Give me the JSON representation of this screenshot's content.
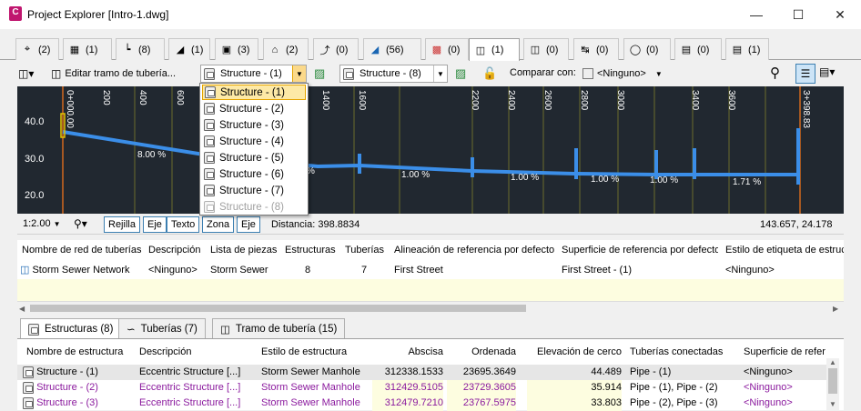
{
  "window": {
    "title": "Project Explorer [Intro-1.dwg]",
    "app_icon": "C"
  },
  "top_tabs": [
    {
      "count": "(2)"
    },
    {
      "count": "(1)"
    },
    {
      "count": "(8)"
    },
    {
      "count": "(1)"
    },
    {
      "count": "(3)"
    },
    {
      "count": "(2)"
    },
    {
      "count": "(0)"
    },
    {
      "count": "(56)"
    },
    {
      "count": "(0)"
    },
    {
      "count": "(1)"
    },
    {
      "count": "(0)"
    },
    {
      "count": "(0)"
    },
    {
      "count": "(0)"
    },
    {
      "count": "(0)"
    },
    {
      "count": "(1)"
    }
  ],
  "toolbar": {
    "edit_label": "Editar tramo de tubería...",
    "start_structure": "Structure - (1)",
    "end_structure": "Structure - (8)",
    "compare_label": "Comparar con:",
    "compare_value": "<Ninguno>"
  },
  "profile": {
    "y_labels": [
      "40.0",
      "30.0",
      "20.0"
    ],
    "x_labels": [
      "0+000.00",
      "200",
      "400",
      "600",
      "1400",
      "1600",
      "2200",
      "2400",
      "2600",
      "2800",
      "3000",
      "3400",
      "3600",
      "3+398.83"
    ],
    "slopes": [
      "8.00 %",
      "%",
      "1.00 %",
      "1.00 %",
      "1.00 %",
      "1.00 %",
      "1.71 %"
    ]
  },
  "status": {
    "scale": "1:2.00",
    "buttons": [
      "Rejilla",
      "Eje",
      "Texto",
      "Zona",
      "Eje"
    ],
    "distance": "Distancia: 398.8834",
    "coords": "143.657, 24.178"
  },
  "network_grid": {
    "headers": [
      "Nombre de red de tuberías",
      "Descripción",
      "Lista de piezas",
      "Estructuras",
      "Tuberías",
      "Alineación de referencia por defecto",
      "Superficie de referencia por defecto",
      "Estilo de etiqueta de estruct"
    ],
    "row": [
      "Storm Sewer Network",
      "<Ninguno>",
      "Storm Sewer",
      "8",
      "7",
      "First Street",
      "First Street - (1)",
      "<Ninguno>"
    ]
  },
  "bottom_tabs": [
    "Estructuras (8)",
    "Tuberías (7)",
    "Tramo de tubería (15)"
  ],
  "structures_grid": {
    "headers": [
      "Nombre de estructura",
      "Descripción",
      "Estilo de estructura",
      "Abscisa",
      "Ordenada",
      "Elevación de cerco",
      "Tuberías conectadas",
      "Superficie de refere"
    ],
    "rows": [
      [
        "Structure - (1)",
        "Eccentric Structure  [...]",
        "Storm Sewer Manhole",
        "312338.1533",
        "23695.3649",
        "44.489",
        "Pipe - (1)",
        "<Ninguno>"
      ],
      [
        "Structure - (2)",
        "Eccentric Structure  [...]",
        "Storm Sewer Manhole",
        "312429.5105",
        "23729.3605",
        "35.914",
        "Pipe - (1), Pipe - (2)",
        "<Ninguno>"
      ],
      [
        "Structure - (3)",
        "Eccentric Structure  [...]",
        "Storm Sewer Manhole",
        "312479.7210",
        "23767.5975",
        "33.803",
        "Pipe - (2), Pipe - (3)",
        "<Ninguno>"
      ]
    ]
  },
  "dropdown": {
    "items": [
      "Structure - (1)",
      "Structure - (2)",
      "Structure - (3)",
      "Structure - (4)",
      "Structure - (5)",
      "Structure - (6)",
      "Structure - (7)",
      "Structure - (8)"
    ]
  },
  "colors": {
    "accent": "#e5a400",
    "profile_bg": "#212830",
    "pipe": "#3b8ee8",
    "station": "#d2691e",
    "purple_row": "#8b1a9e"
  }
}
